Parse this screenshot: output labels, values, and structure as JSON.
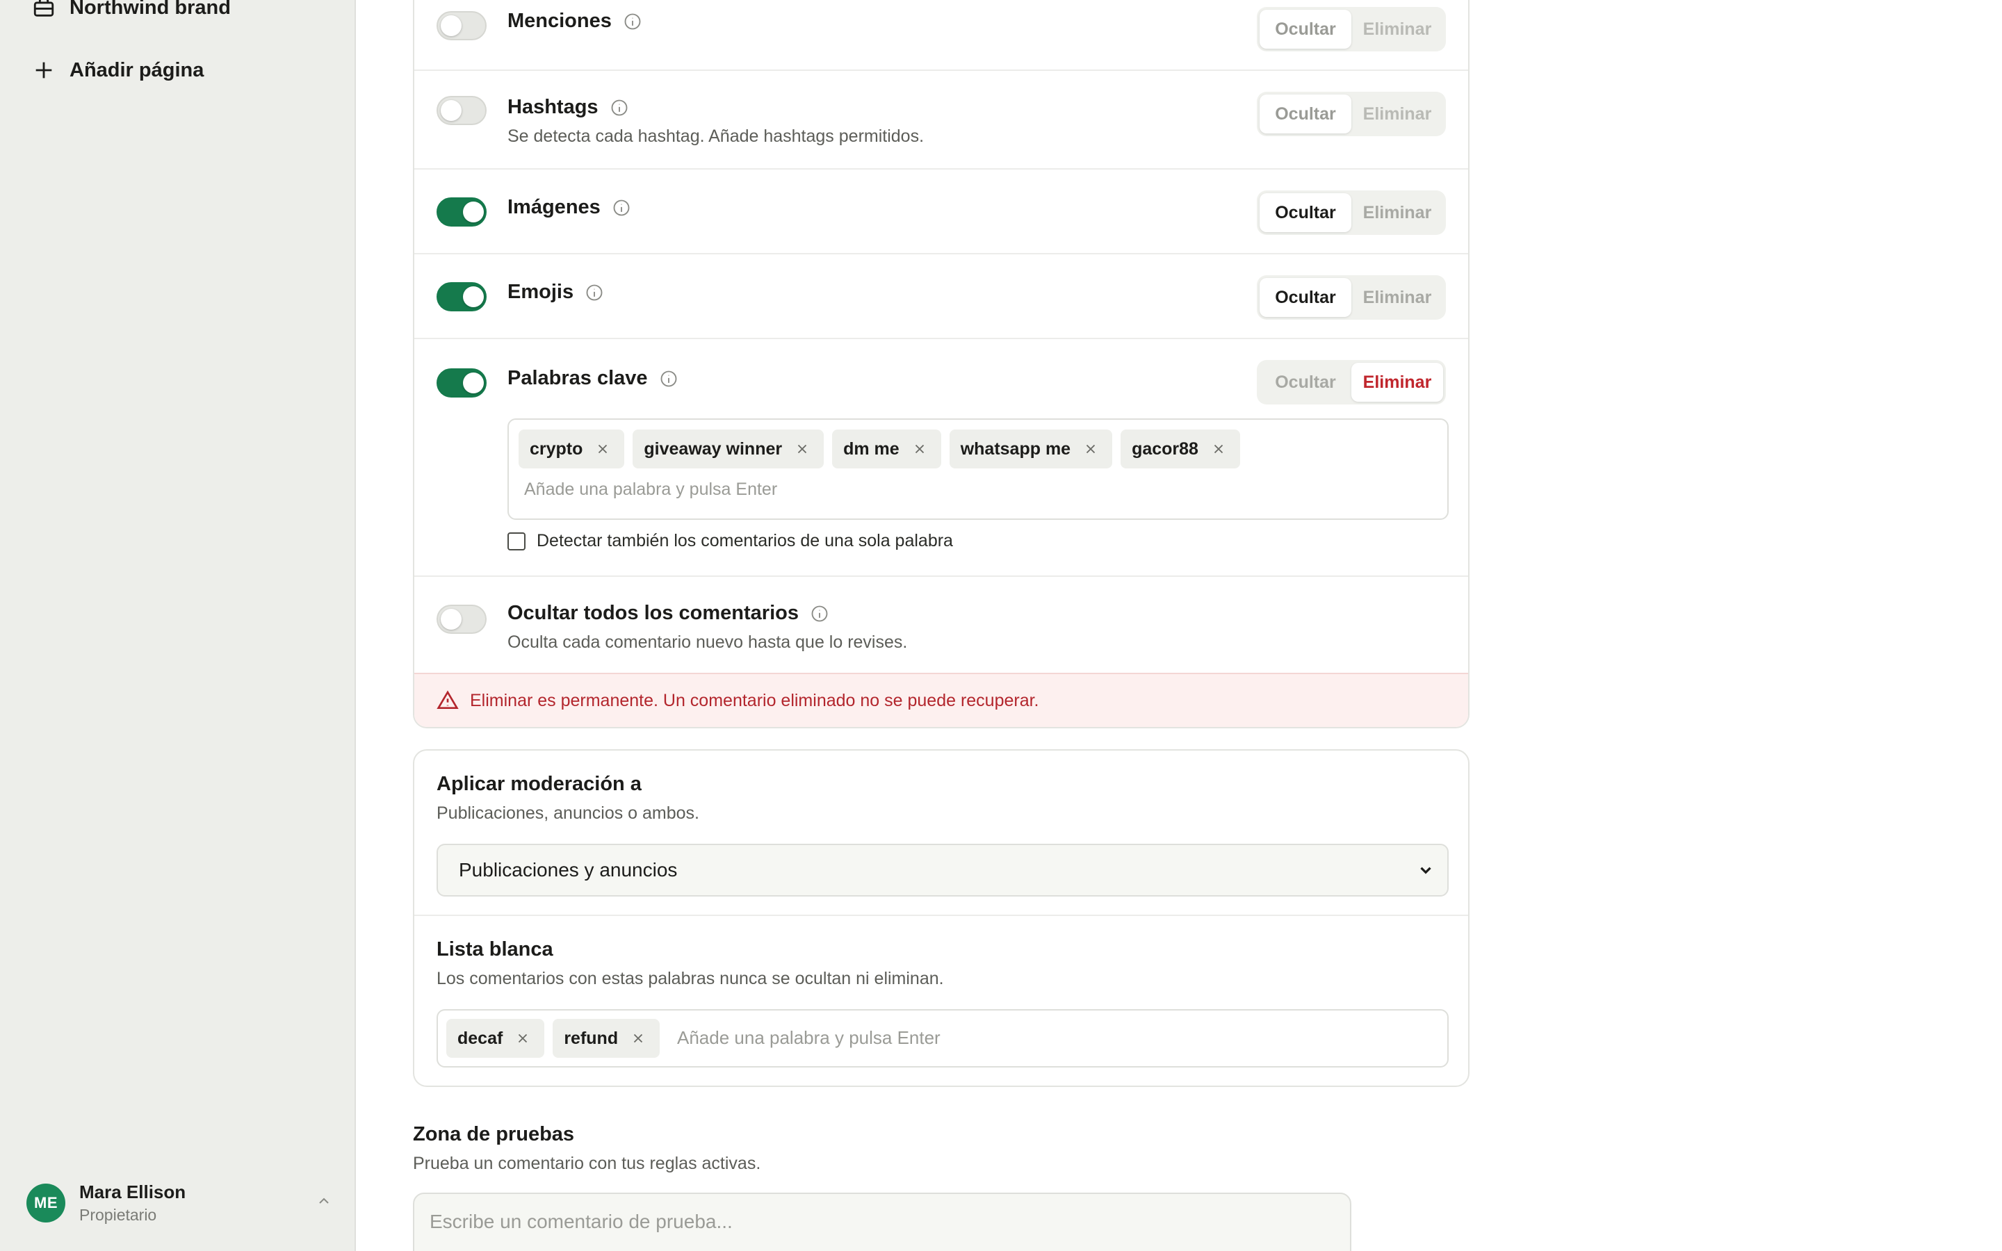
{
  "sidebar": {
    "items": [
      {
        "label": "Northwind brand",
        "icon": "briefcase-icon"
      },
      {
        "label": "Añadir página",
        "icon": "plus-icon"
      }
    ],
    "user": {
      "initials": "ME",
      "name": "Mara Ellison",
      "role": "Propietario",
      "avatar_color": "#1a8a5a"
    }
  },
  "moderation": {
    "rules": [
      {
        "title": "Menciones",
        "description": "",
        "enabled": false,
        "action": "Ocultar",
        "options": [
          "Ocultar",
          "Eliminar"
        ]
      },
      {
        "title": "Hashtags",
        "description": "Se detecta cada hashtag. Añade hashtags permitidos.",
        "enabled": false,
        "action": "Ocultar",
        "options": [
          "Ocultar",
          "Eliminar"
        ]
      },
      {
        "title": "Imágenes",
        "description": "",
        "enabled": true,
        "action": "Ocultar",
        "options": [
          "Ocultar",
          "Eliminar"
        ]
      },
      {
        "title": "Emojis",
        "description": "",
        "enabled": true,
        "action": "Ocultar",
        "options": [
          "Ocultar",
          "Eliminar"
        ]
      },
      {
        "title": "Palabras clave",
        "description": "",
        "enabled": true,
        "action": "Eliminar",
        "options": [
          "Ocultar",
          "Eliminar"
        ]
      },
      {
        "title": "Ocultar todos los comentarios",
        "description": "Oculta cada comentario nuevo hasta que lo revises.",
        "enabled": false
      }
    ],
    "keywords": {
      "tags": [
        "crypto",
        "giveaway winner",
        "dm me",
        "whatsapp me",
        "gacor88"
      ],
      "placeholder": "Añade una palabra y pulsa Enter",
      "single_word_label": "Detectar también los comentarios de una sola palabra",
      "single_word_checked": false
    },
    "warning": "Eliminar es permanente. Un comentario eliminado no se puede recuperar."
  },
  "apply": {
    "title": "Aplicar moderación a",
    "description": "Publicaciones, anuncios o ambos.",
    "selected": "Publicaciones y anuncios"
  },
  "whitelist": {
    "title": "Lista blanca",
    "description": "Los comentarios con estas palabras nunca se ocultan ni eliminan.",
    "tags": [
      "decaf",
      "refund"
    ],
    "placeholder": "Añade una palabra y pulsa Enter"
  },
  "test_zone": {
    "title": "Zona de pruebas",
    "description": "Prueba un comentario con tus reglas activas.",
    "placeholder": "Escribe un comentario de prueba..."
  },
  "colors": {
    "accent": "#157a4c",
    "danger": "#c0262d",
    "sidebar_bg": "#edeeea"
  }
}
